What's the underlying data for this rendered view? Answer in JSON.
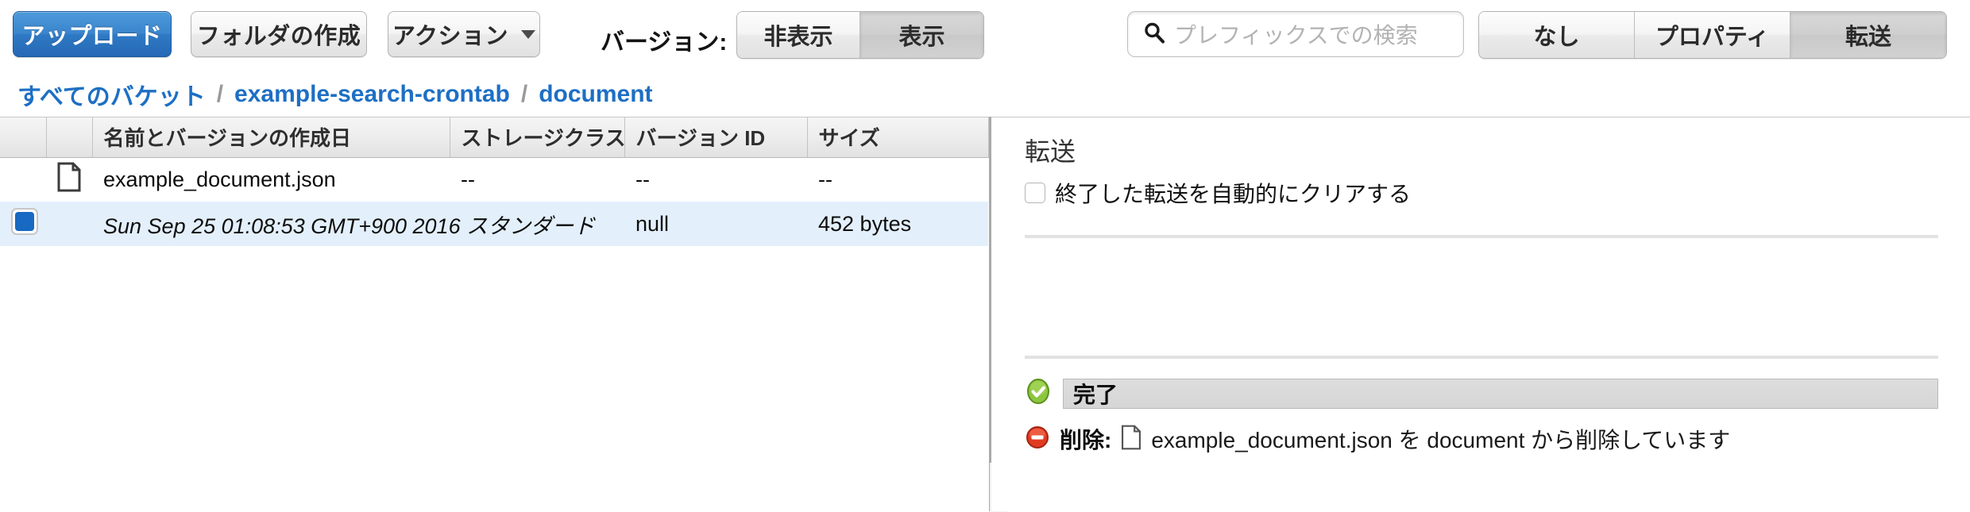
{
  "toolbar": {
    "upload_label": "アップロード",
    "new_folder_label": "フォルダの作成",
    "actions_label": "アクション",
    "version_label": "バージョン:",
    "version_segments": [
      {
        "label": "非表示",
        "active": false
      },
      {
        "label": "表示",
        "active": true
      }
    ],
    "search": {
      "value": "",
      "placeholder": "プレフィックスでの検索",
      "icon": "search-icon"
    },
    "panel_segments": [
      {
        "label": "なし",
        "active": false
      },
      {
        "label": "プロパティ",
        "active": false
      },
      {
        "label": "転送",
        "active": true
      }
    ]
  },
  "breadcrumb": {
    "separator": "/",
    "items": [
      {
        "label": "すべてのバケット"
      },
      {
        "label": "example-search-crontab"
      },
      {
        "label": "document"
      }
    ]
  },
  "table": {
    "headers": [
      "",
      "",
      "名前とバージョンの作成日",
      "ストレージクラス",
      "バージョン ID",
      "サイズ"
    ],
    "rows": [
      {
        "selected": false,
        "checkbox": "",
        "icon": "file-icon",
        "name": "example_document.json",
        "storage_class": "--",
        "version_id": "--",
        "size": "--"
      },
      {
        "selected": true,
        "checkbox": "checked",
        "icon": "",
        "name": "Sun Sep 25 01:08:53 GMT+900 2016 スタンダード",
        "storage_class": "",
        "version_id": "null",
        "size": "452 bytes"
      }
    ]
  },
  "right_panel": {
    "title": "転送",
    "auto_clear_label": "終了した転送を自動的にクリアする",
    "auto_clear_checked": false,
    "progress": {
      "status_icon": "success-check-icon",
      "status_text": "完了",
      "percent": 100
    },
    "transfer": {
      "status_icon": "error-delete-icon",
      "action_label": "削除:",
      "file_icon": "file-icon",
      "message": "example_document.json を document から削除しています"
    }
  },
  "colors": {
    "primary_button": "#2f79c4",
    "link": "#1d6fc4",
    "row_selected": "#e3f0fb",
    "checkbox_fill": "#1769c2",
    "success": "#76b82a",
    "error": "#e03b20"
  }
}
